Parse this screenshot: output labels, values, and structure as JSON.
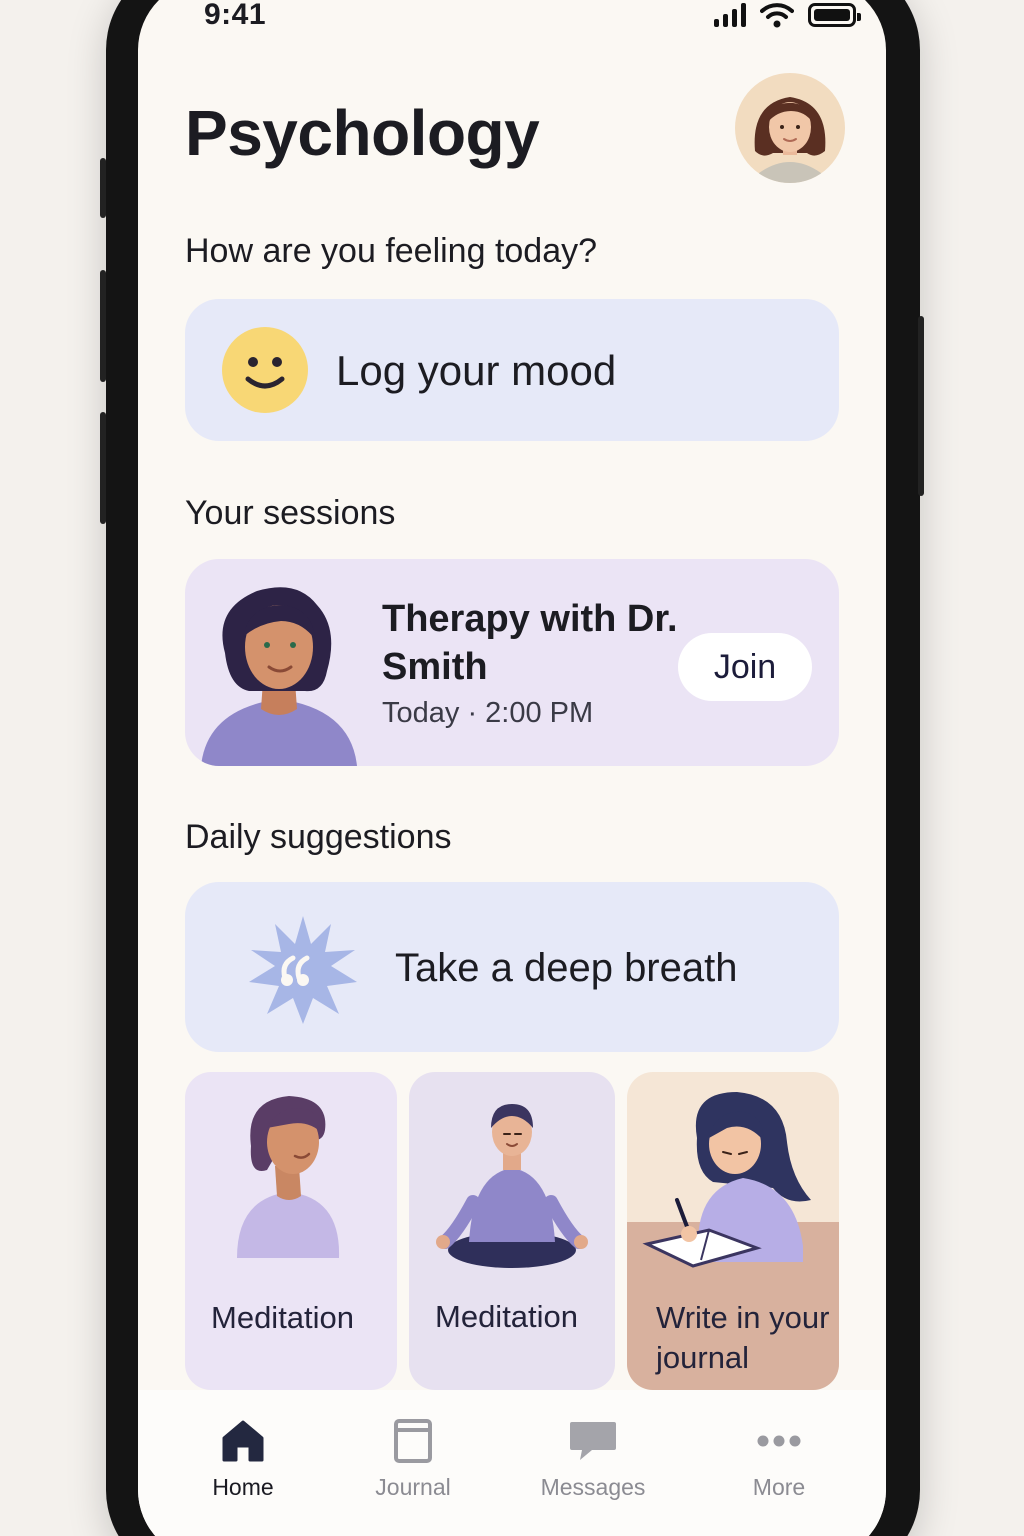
{
  "status_bar": {
    "time": "9:41"
  },
  "header": {
    "title": "Psychology"
  },
  "mood": {
    "prompt": "How are you feeling today?",
    "action_label": "Log your mood"
  },
  "sessions": {
    "section_title": "Your sessions",
    "item": {
      "title": "Therapy with Dr. Smith",
      "time": "Today · 2:00 PM",
      "join_label": "Join"
    }
  },
  "suggestions": {
    "section_title": "Daily suggestions",
    "featured": "Take a deep breath",
    "tiles": [
      {
        "label": "Meditation"
      },
      {
        "label": "Meditation"
      },
      {
        "label": "Write in your journal"
      }
    ]
  },
  "tabbar": {
    "items": [
      {
        "label": "Home",
        "icon": "home-icon",
        "active": true
      },
      {
        "label": "Journal",
        "icon": "journal-icon",
        "active": false
      },
      {
        "label": "Messages",
        "icon": "messages-icon",
        "active": false
      },
      {
        "label": "More",
        "icon": "more-icon",
        "active": false
      }
    ]
  },
  "colors": {
    "background": "#fbf8f3",
    "blue_card": "#e6e9f8",
    "lavender_card": "#ebe4f5",
    "peach_card": "#f5e6d6",
    "accent_purple": "#8f87c9",
    "smiley_yellow": "#f8d775"
  }
}
